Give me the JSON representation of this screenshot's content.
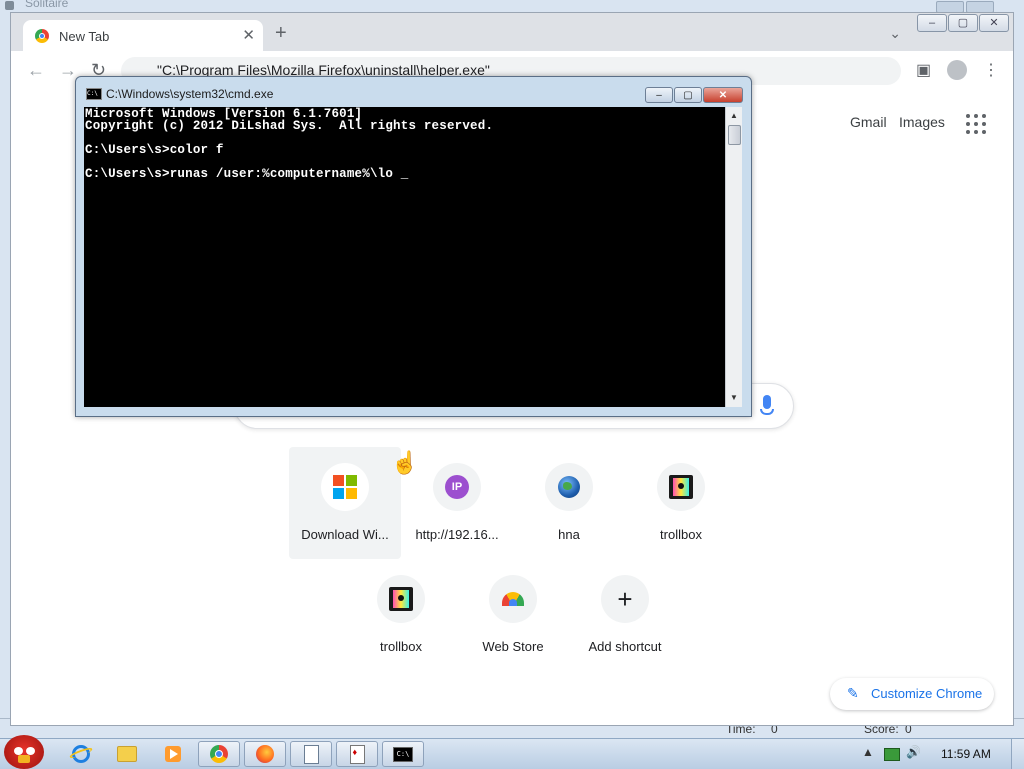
{
  "solitaire": {
    "title": "Solitaire",
    "time_label": "Time:",
    "time_value": "0",
    "score_label": "Score:",
    "score_value": "0"
  },
  "chrome": {
    "tab_title": "New Tab",
    "tab_close": "✕",
    "new_tab": "+",
    "tab_list": "⌄",
    "window_controls": [
      "–",
      "▢",
      "✕"
    ],
    "nav": {
      "back": "←",
      "forward": "→",
      "reload": "↻"
    },
    "omnibox_text": "\"C:\\Program Files\\Mozilla Firefox\\uninstall\\helper.exe\"",
    "side_panel": "▣",
    "menu": "⋮",
    "header_links": {
      "gmail": "Gmail",
      "images": "Images"
    },
    "shortcuts": [
      {
        "label": "Download Wi...",
        "icon": "windows-logo-icon"
      },
      {
        "label": "http://192.16...",
        "icon": "ip-icon",
        "icon_text": "IP"
      },
      {
        "label": "hna",
        "icon": "globe-icon"
      },
      {
        "label": "trollbox",
        "icon": "trollbox-icon"
      },
      {
        "label": "trollbox",
        "icon": "trollbox-icon"
      },
      {
        "label": "Web Store",
        "icon": "web-store-icon"
      },
      {
        "label": "Add shortcut",
        "icon": "plus-icon",
        "icon_text": "+"
      }
    ],
    "customize_label": "Customize Chrome"
  },
  "cmd": {
    "title": "C:\\Windows\\system32\\cmd.exe",
    "icon_text": "C:\\",
    "controls": [
      "–",
      "▢",
      "✕"
    ],
    "lines": [
      "Microsoft Windows [Version 6.1.7601]",
      "Copyright (c) 2012 DiLshad Sys.  All rights reserved.",
      "",
      "C:\\Users\\s>color f",
      "",
      "C:\\Users\\s>runas /user:%computername%\\lo _"
    ]
  },
  "taskbar": {
    "clock": "11:59 AM",
    "tray_arrow": "▲",
    "volume": "🔊",
    "cmd_icon_text": "C:\\"
  }
}
